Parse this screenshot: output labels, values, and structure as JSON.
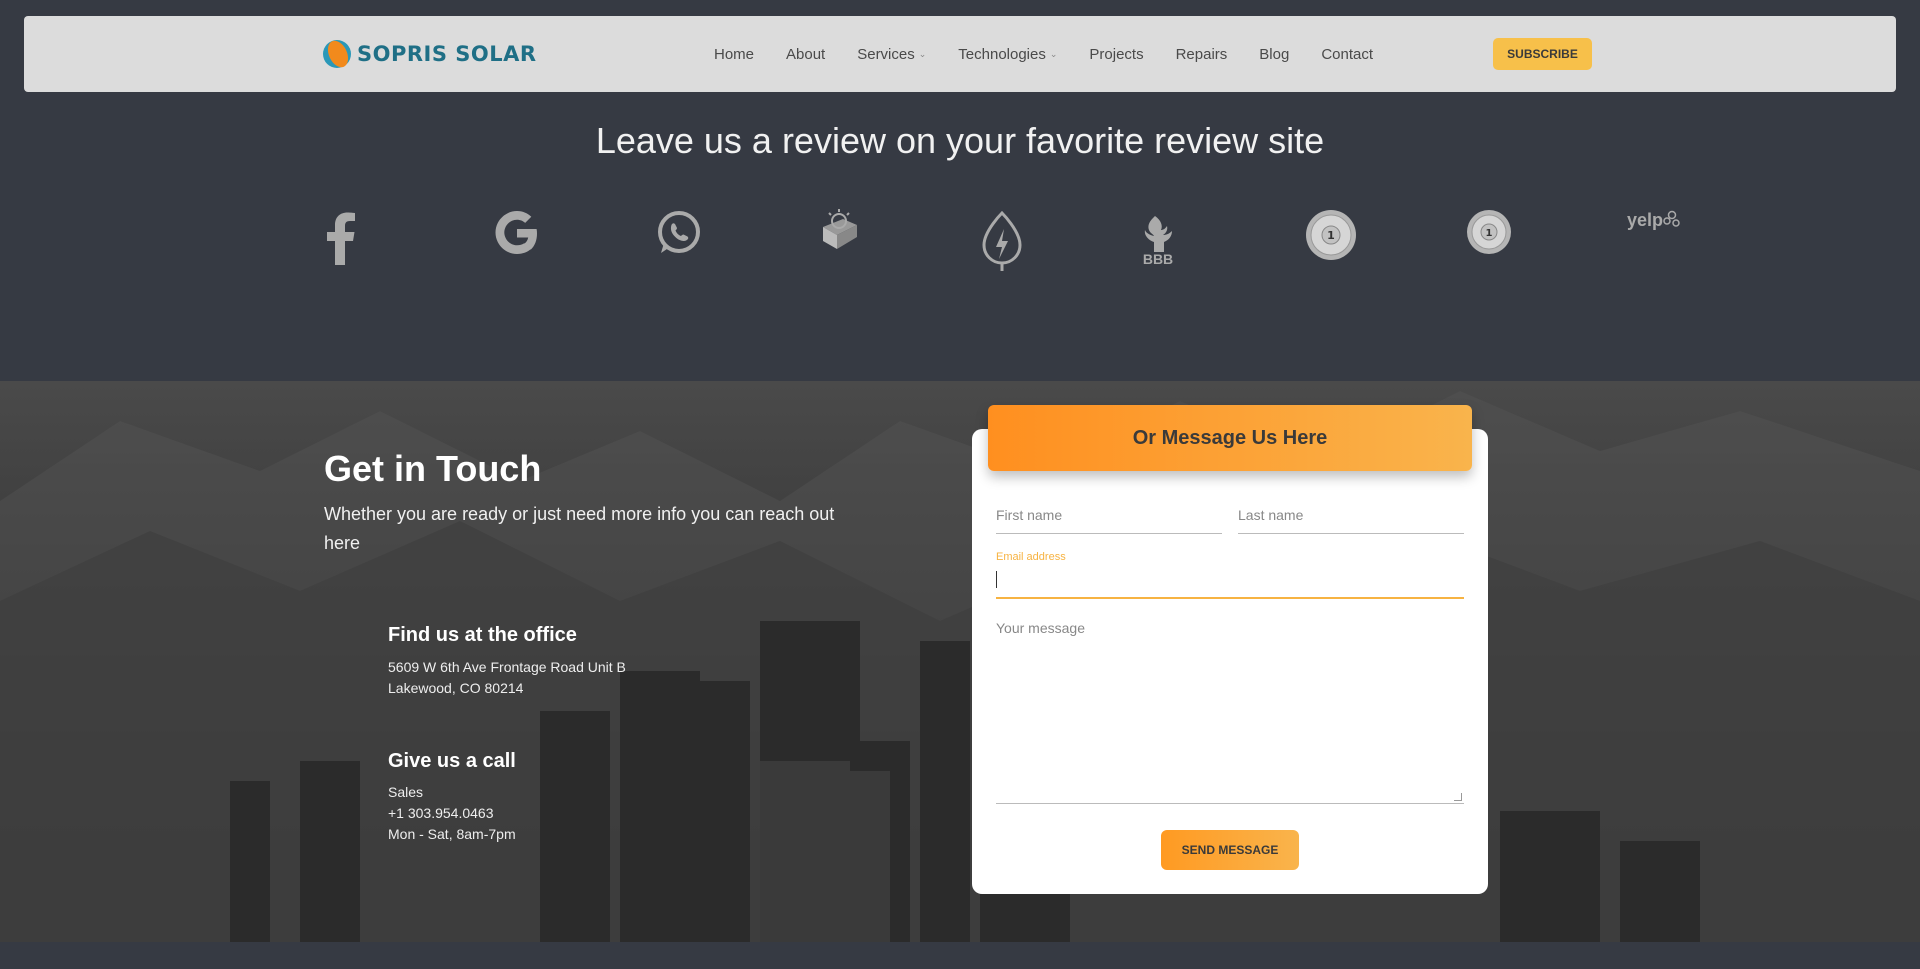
{
  "brand": {
    "name": "SOPRIS SOLAR"
  },
  "nav": {
    "items": [
      {
        "label": "Home",
        "dropdown": false
      },
      {
        "label": "About",
        "dropdown": false
      },
      {
        "label": "Services",
        "dropdown": true
      },
      {
        "label": "Technologies",
        "dropdown": true
      },
      {
        "label": "Projects",
        "dropdown": false
      },
      {
        "label": "Repairs",
        "dropdown": false
      },
      {
        "label": "Blog",
        "dropdown": false
      },
      {
        "label": "Contact",
        "dropdown": false
      }
    ],
    "subscribe_label": "SUBSCRIBE"
  },
  "reviews": {
    "title": "Leave us a review on your favorite review site",
    "sites": [
      "facebook-icon",
      "google-icon",
      "whatsapp-icon",
      "solar-reviews-icon",
      "energysage-icon",
      "bbb-icon",
      "badge-1-icon",
      "badge-2-icon",
      "yelp-icon"
    ],
    "bbb_text": "BBB",
    "yelp_text": "yelp",
    "badge_text": "1"
  },
  "contact": {
    "title": "Get in Touch",
    "subtitle": "Whether you are ready or just need more info you can reach out here",
    "office": {
      "heading": "Find us at the office",
      "address_line1": "5609 W 6th Ave Frontage Road Unit B",
      "address_line2": "Lakewood, CO 80214"
    },
    "call": {
      "heading": "Give us a call",
      "line1": "Sales",
      "phone": "+1 303.954.0463",
      "hours": "Mon - Sat, 8am-7pm"
    }
  },
  "form": {
    "header": "Or Message Us Here",
    "first_name_placeholder": "First name",
    "last_name_placeholder": "Last name",
    "email_label": "Email address",
    "email_value": "",
    "message_placeholder": "Your message",
    "send_label": "SEND MESSAGE"
  },
  "colors": {
    "accent": "#f7c04a",
    "orange": "#ff8f1f",
    "page_bg": "#363a43",
    "navbar_bg": "#dcdcdc",
    "logo_text": "#1f6f86"
  }
}
